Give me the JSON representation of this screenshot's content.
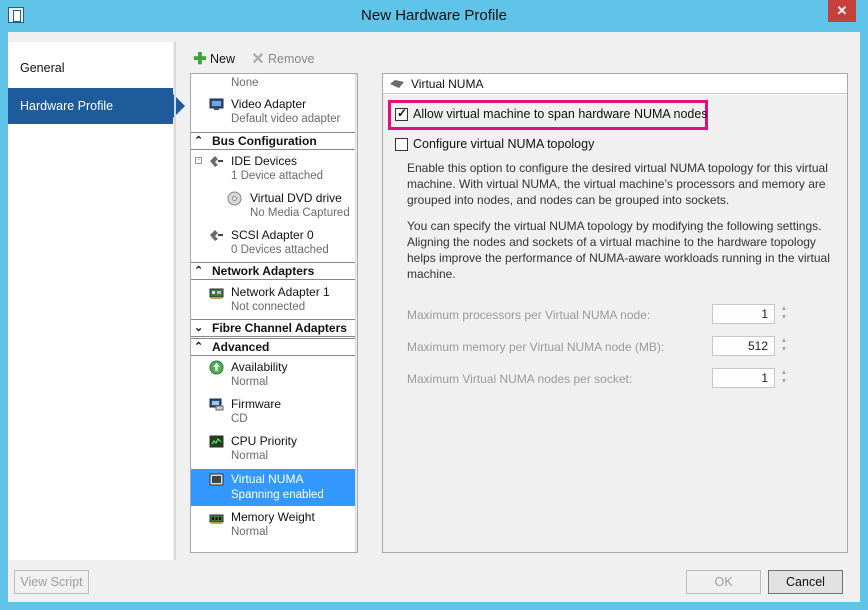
{
  "window": {
    "title": "New Hardware Profile",
    "close_glyph": "✕"
  },
  "nav": {
    "items": [
      {
        "label": "General"
      },
      {
        "label": "Hardware Profile"
      }
    ]
  },
  "toolbar": {
    "new_label": "New",
    "remove_label": "Remove"
  },
  "tree": {
    "items": [
      {
        "label": "",
        "sub": "None"
      },
      {
        "label": "Video Adapter",
        "sub": "Default video adapter"
      },
      {
        "section": "Bus Configuration"
      },
      {
        "label": "IDE Devices",
        "sub": "1 Device attached"
      },
      {
        "label": "Virtual DVD drive",
        "sub": "No Media Captured"
      },
      {
        "label": "SCSI Adapter 0",
        "sub": "0 Devices attached"
      },
      {
        "section": "Network Adapters"
      },
      {
        "label": "Network Adapter 1",
        "sub": "Not connected"
      },
      {
        "section": "Fibre Channel Adapters"
      },
      {
        "section": "Advanced"
      },
      {
        "label": "Availability",
        "sub": "Normal"
      },
      {
        "label": "Firmware",
        "sub": "CD"
      },
      {
        "label": "CPU Priority",
        "sub": "Normal"
      },
      {
        "label": "Virtual NUMA",
        "sub": "Spanning enabled"
      },
      {
        "label": "Memory Weight",
        "sub": "Normal"
      }
    ],
    "grip": "≡"
  },
  "pane": {
    "title": "Virtual NUMA",
    "allow_span_label": "Allow virtual machine to span hardware NUMA nodes",
    "allow_span_checked": true,
    "configure_label": "Configure virtual NUMA topology",
    "configure_checked": false,
    "desc1": "Enable this option to configure the desired virtual NUMA topology for this virtual machine. With virtual NUMA, the virtual machine’s processors and memory are grouped into nodes, and nodes can be grouped into sockets.",
    "desc2": "You can specify the virtual NUMA topology by modifying the following settings. Aligning the nodes and sockets of a virtual machine to the hardware topology helps improve the performance of NUMA-aware workloads running in the virtual machine.",
    "settings": [
      {
        "label": "Maximum processors per Virtual NUMA node:",
        "value": "1"
      },
      {
        "label": "Maximum memory per Virtual NUMA node (MB):",
        "value": "512"
      },
      {
        "label": "Maximum Virtual NUMA nodes per socket:",
        "value": "1"
      }
    ]
  },
  "footer": {
    "view_script": "View Script",
    "ok": "OK",
    "cancel": "Cancel"
  },
  "colors": {
    "title_bar": "#5fc4e8",
    "nav_active": "#1d5b9a",
    "selection": "#3399ff",
    "highlight_box": "#e0107a"
  }
}
